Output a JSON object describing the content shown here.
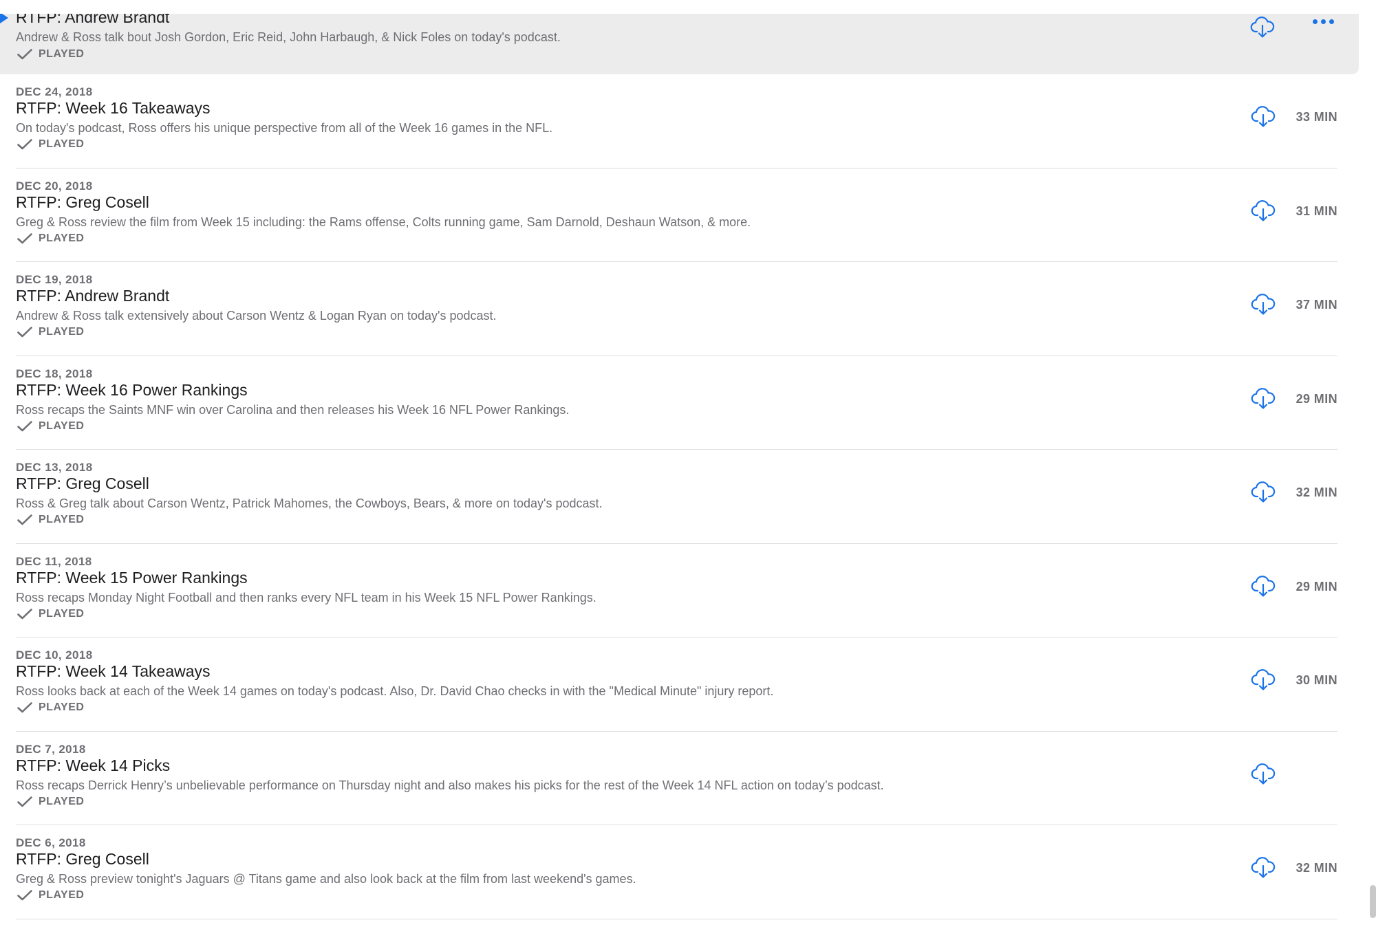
{
  "accent_color": "#1a73e8",
  "episodes": [
    {
      "date": "",
      "title": "RTFP: Andrew Brandt",
      "description": "Andrew & Ross talk bout Josh Gordon, Eric Reid, John Harbaugh, & Nick Foles on today's podcast.",
      "status": "PLAYED",
      "duration": "",
      "selected": true,
      "playing": true
    },
    {
      "date": "DEC 24, 2018",
      "title": "RTFP: Week 16 Takeaways",
      "description": "On today's podcast, Ross offers his unique perspective from all of the Week 16 games in the NFL.",
      "status": "PLAYED",
      "duration": "33 MIN"
    },
    {
      "date": "DEC 20, 2018",
      "title": "RTFP: Greg Cosell",
      "description": "Greg & Ross review the film from Week 15  including: the Rams offense, Colts running game, Sam Darnold, Deshaun Watson, & more.",
      "status": "PLAYED",
      "duration": "31 MIN"
    },
    {
      "date": "DEC 19, 2018",
      "title": "RTFP: Andrew Brandt",
      "description": "Andrew & Ross talk extensively about  Carson Wentz & Logan Ryan on today's podcast.",
      "status": "PLAYED",
      "duration": "37 MIN"
    },
    {
      "date": "DEC 18, 2018",
      "title": "RTFP: Week 16 Power Rankings",
      "description": "Ross recaps the Saints MNF win over Carolina and then releases his Week 16 NFL Power Rankings.",
      "status": "PLAYED",
      "duration": "29 MIN"
    },
    {
      "date": "DEC 13, 2018",
      "title": "RTFP: Greg Cosell",
      "description": "Ross & Greg talk about Carson Wentz, Patrick Mahomes, the Cowboys, Bears, & more on today's podcast.",
      "status": "PLAYED",
      "duration": "32 MIN"
    },
    {
      "date": "DEC 11, 2018",
      "title": "RTFP: Week 15 Power Rankings",
      "description": "Ross recaps Monday Night Football and then ranks every NFL team in his Week 15 NFL Power Rankings.",
      "status": "PLAYED",
      "duration": "29 MIN"
    },
    {
      "date": "DEC 10, 2018",
      "title": "RTFP: Week 14 Takeaways",
      "description": "Ross looks back at each of the Week 14 games on today's podcast.  Also, Dr. David Chao checks in with the \"Medical Minute\" injury report.",
      "status": "PLAYED",
      "duration": "30 MIN"
    },
    {
      "date": "DEC 7, 2018",
      "title": "RTFP: Week 14 Picks",
      "description": "Ross recaps Derrick Henry’s unbelievable performance on Thursday night and also makes his picks for the rest of the Week 14 NFL action on today’s podcast.",
      "status": "PLAYED",
      "duration": ""
    },
    {
      "date": "DEC 6, 2018",
      "title": "RTFP: Greg Cosell",
      "description": "Greg & Ross preview tonight's Jaguars @ Titans game and also look back at the film from last weekend's games.",
      "status": "PLAYED",
      "duration": "32 MIN"
    }
  ]
}
